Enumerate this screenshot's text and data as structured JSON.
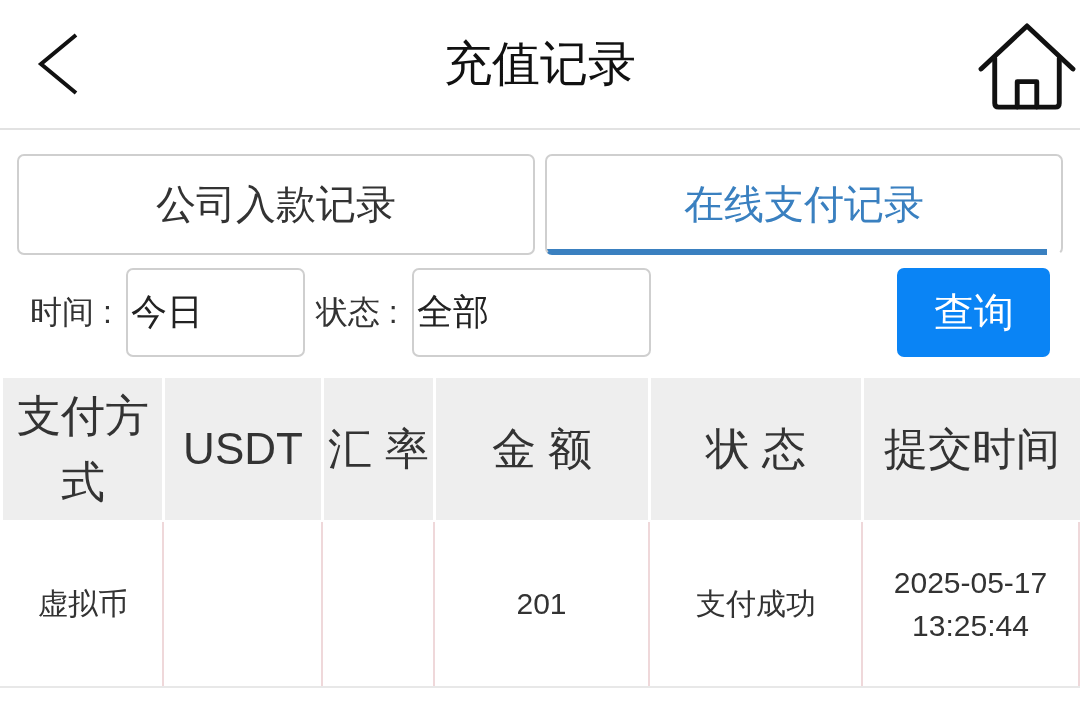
{
  "header": {
    "title": "充值记录"
  },
  "tabs": [
    {
      "label": "公司入款记录",
      "selected": false
    },
    {
      "label": "在线支付记录",
      "selected": true
    }
  ],
  "filters": {
    "time": {
      "label": "时间 :",
      "value": "今日"
    },
    "status": {
      "label": "状态 :",
      "value": "全部"
    },
    "query_button": "查询"
  },
  "table": {
    "columns": [
      "支付方式",
      "USDT",
      "汇 率",
      "金 额",
      "状 态",
      "提交时间"
    ],
    "rows": [
      [
        "虚拟币",
        null,
        null,
        "201",
        "支付成功",
        "2025-05-17 13:25:44"
      ]
    ]
  }
}
